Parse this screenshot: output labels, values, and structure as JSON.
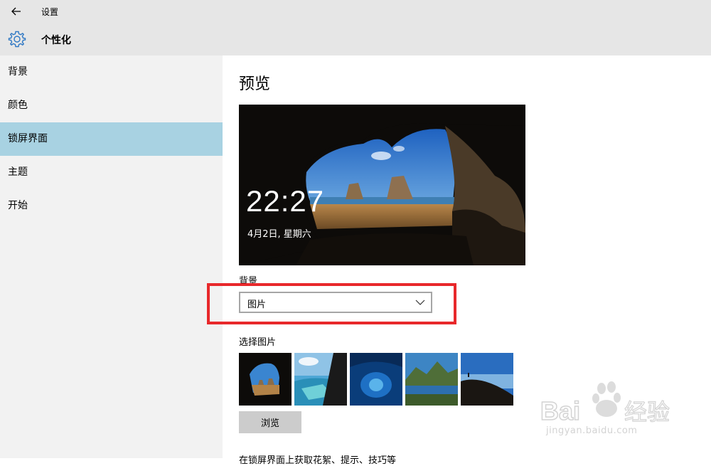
{
  "app": {
    "title": "设置"
  },
  "header": {
    "title": "个性化"
  },
  "sidebar": {
    "items": [
      {
        "label": "背景"
      },
      {
        "label": "颜色"
      },
      {
        "label": "锁屏界面"
      },
      {
        "label": "主题"
      },
      {
        "label": "开始"
      }
    ],
    "active_index": 2
  },
  "main": {
    "preview_title": "预览",
    "lock_time": "22:27",
    "lock_date": "4月2日, 星期六",
    "background_label": "背景",
    "background_value": "图片",
    "choose_picture_label": "选择图片",
    "browse_label": "浏览",
    "truncated_text": "在锁屏界面上获取花絮、提示、技巧等"
  },
  "watermark": {
    "text": "jingyan.baidu.com"
  },
  "colors": {
    "titlebar": "#e6e6e6",
    "sidebar": "#f2f2f2",
    "active_item": "#a8d2e2",
    "highlight_box": "#e8282b",
    "browse_button": "#cccccc"
  },
  "icons": [
    "back-arrow-icon",
    "gear-icon",
    "chevron-down-icon",
    "baidu-paw-logo"
  ]
}
